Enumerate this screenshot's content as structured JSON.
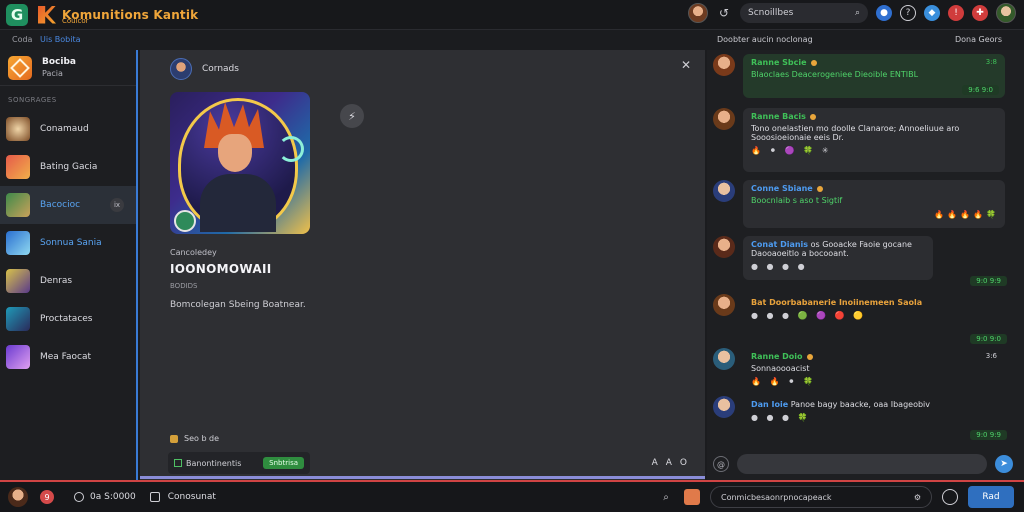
{
  "topbar": {
    "app_title": "Komunitions Kantik",
    "app_subtitle": "Coulcor",
    "search_text": "Scnoillbes",
    "search_icon": "search-icon"
  },
  "subhead": {
    "left1": "Coda",
    "left2": "Uis Bobita",
    "right1": "Doobter aucin noclonag",
    "right2": "Dona Geors"
  },
  "sidebar": {
    "server_name": "Bociba",
    "server_sub": "Pacia",
    "section": "SONGRAGES",
    "items": [
      {
        "label": "Conamaud"
      },
      {
        "label": "Bating Gacia"
      },
      {
        "label": "Bacocioc",
        "badge": "ix"
      },
      {
        "label": "Sonnua Sania"
      },
      {
        "label": "Denras"
      },
      {
        "label": "Proctataces"
      },
      {
        "label": "Mea Faocat"
      }
    ]
  },
  "center": {
    "profile_name": "Cornads",
    "caption": "Cancoledey",
    "title": "IOONOMOWAII",
    "tag": "BODIDS",
    "description": "Bomcolegan Sbeing Boatnear.",
    "foot_label": "Seo b de",
    "foot_bar_text": "Banontinentis",
    "foot_pill": "Snbtrisa",
    "tools": [
      "A",
      "A",
      "O"
    ]
  },
  "chat": {
    "messages": [
      {
        "name": "Ranne Sbcie",
        "time": "3:8",
        "text": "Blaoclaes Deacerogeniee Dieoible ENTIBL",
        "stamp": "9:6 9:0",
        "style": "green"
      },
      {
        "name": "Ranne Bacis",
        "time": "",
        "text": "Tono onelastien mo doolle Clanaroe; Annoeliuue aro Sooosioeionaie eeis Dr.",
        "emojis": "🔥 ⚫ 🟣 🍀 ✳",
        "style": "plain"
      },
      {
        "name": "Conne Sbiane",
        "time": "",
        "text": "Boocnlaib s aso t Sigtif",
        "emojis": "🔥🔥🔥🔥🍀",
        "style": "plain"
      },
      {
        "name": "Conat Dianis",
        "time": "",
        "text": "os Gooacke Faoie gocane Daooaoeitlo a bocooant.",
        "emojis": "● ● ● ●",
        "stamp": "9:0 9:9",
        "style": "plain"
      },
      {
        "name": "Bat Doorbabanerie Inoiinemeen Saola",
        "time": "",
        "text": "",
        "emojis": "● ● ● 🟢 🟣 🔴 🟡",
        "stamp": "9:0 9:0",
        "style": "none"
      },
      {
        "name": "Ranne Doio",
        "time": "3:6",
        "text": "Sonnaoooacist",
        "emojis": "🔥 🔥 ⚫ 🍀",
        "style": "none"
      },
      {
        "name": "Dan Ioie",
        "time": "",
        "text": "Panoe bagy baacke, oaa Ibageobiv",
        "emojis": "● ● ● 🍀",
        "stamp": "9:0 9:9",
        "style": "none"
      }
    ]
  },
  "bottombar": {
    "badge": "9",
    "status": "0a S:0000",
    "channel": "Conosunat",
    "search_text": "Conmicbesaonrpnocapeack",
    "button": "Rad"
  }
}
